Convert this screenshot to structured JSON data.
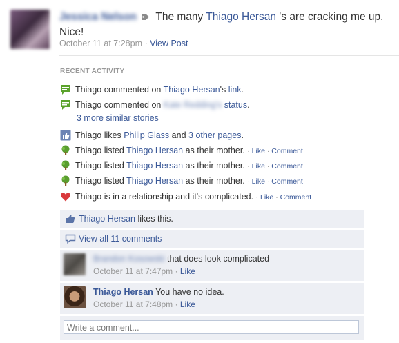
{
  "post": {
    "author": "Jessica Nelson",
    "text": "The many",
    "tagged": "Thiago Hersan",
    "text_after": "'s are cracking me up. Nice!",
    "time": "October 11 at 7:28pm",
    "view_post": "View Post"
  },
  "recent_activity": {
    "title": "RECENT ACTIVITY",
    "row1": {
      "subject": "Thiago commented on",
      "link": "Thiago Hersan",
      "suffix": "'s",
      "link2": "link",
      "end": "."
    },
    "row2": {
      "subject": "Thiago commented on",
      "hidden": "Kate Redding's",
      "link": "status",
      "end": "."
    },
    "more": "3 more similar stories",
    "row3": {
      "subject": "Thiago likes",
      "link": "Philip Glass",
      "mid": "and",
      "link2": "3 other pages",
      "end": "."
    },
    "row4": {
      "subject": "Thiago listed",
      "link": "Thiago Hersan",
      "end": "as their mother."
    },
    "row5": {
      "subject": "Thiago listed",
      "link": "Thiago Hersan",
      "end": "as their mother."
    },
    "row6": {
      "subject": "Thiago listed",
      "link": "Thiago Hersan",
      "end": "as their mother."
    },
    "row7": {
      "subject": "Thiago is in a relationship and it's complicated."
    },
    "like": "Like",
    "comment": "Comment",
    "sep": "·"
  },
  "feedback": {
    "likes_name": "Thiago Hersan",
    "likes_text": "likes this.",
    "view_all": "View all 11 comments",
    "comments": [
      {
        "name": "Brandon Kosowski",
        "text": "that does look complicated",
        "time": "October 11 at 7:47pm",
        "like": "Like"
      },
      {
        "name": "Thiago Hersan",
        "text": "You have no idea.",
        "time": "October 11 at 7:48pm",
        "like": "Like"
      }
    ],
    "write_placeholder": "Write a comment..."
  },
  "colors": {
    "link": "#3b5998",
    "panel": "#edeff4",
    "muted": "#999999"
  }
}
